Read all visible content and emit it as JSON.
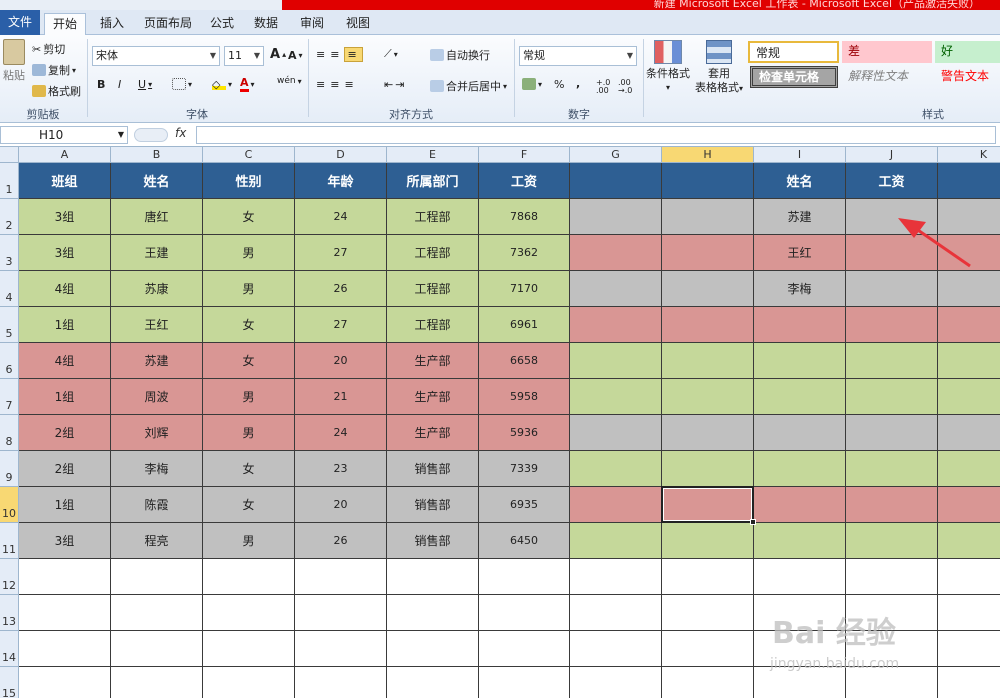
{
  "window": {
    "title": "新建 Microsoft Excel 工作表 - Microsoft Excel（产品激活失败）"
  },
  "tabs": [
    {
      "label": "文件",
      "kind": "file"
    },
    {
      "label": "开始",
      "active": true
    },
    {
      "label": "插入"
    },
    {
      "label": "页面布局"
    },
    {
      "label": "公式"
    },
    {
      "label": "数据"
    },
    {
      "label": "审阅"
    },
    {
      "label": "视图"
    }
  ],
  "ribbon": {
    "clipboard": {
      "paste": "粘贴",
      "cut": "剪切",
      "copy": "复制",
      "format_painter": "格式刷",
      "label": "剪贴板"
    },
    "font": {
      "name": "宋体",
      "size": "11",
      "grow": "A",
      "shrink": "A",
      "bold": "B",
      "italic": "I",
      "underline": "U",
      "font_color_letter": "A",
      "phonetic": "wén",
      "label": "字体"
    },
    "alignment": {
      "wrap_text": "自动换行",
      "merge_center": "合并后居中",
      "label": "对齐方式"
    },
    "number": {
      "format": "常规",
      "percent": "%",
      "comma": ",",
      "inc_decimal": "+.0 .00",
      "dec_decimal": ".00 →.0",
      "label": "数字"
    },
    "styles_btns": {
      "conditional": "条件格式",
      "table_format_1": "套用",
      "table_format_2": "表格格式",
      "label": "样式"
    },
    "styles": [
      {
        "label": "常规",
        "kind": "normal"
      },
      {
        "label": "差",
        "kind": "bad"
      },
      {
        "label": "好",
        "kind": "good"
      },
      {
        "label": "检查单元格",
        "kind": "check"
      },
      {
        "label": "解释性文本",
        "kind": "explain"
      },
      {
        "label": "警告文本",
        "kind": "warn"
      }
    ]
  },
  "formula_bar": {
    "name_box": "H10",
    "fx": "fx",
    "value": ""
  },
  "columns": [
    "A",
    "B",
    "C",
    "D",
    "E",
    "F",
    "G",
    "H",
    "I",
    "J",
    "K"
  ],
  "rows": [
    "1",
    "2",
    "3",
    "4",
    "5",
    "6",
    "7",
    "8",
    "9",
    "10",
    "11",
    "12",
    "13",
    "14",
    "15"
  ],
  "selected_cell": {
    "column": "H",
    "row": "10"
  },
  "table": {
    "headers": [
      "班组",
      "姓名",
      "性别",
      "年龄",
      "所属部门",
      "工资"
    ],
    "rows": [
      [
        "3组",
        "唐红",
        "女",
        "24",
        "工程部",
        "7868"
      ],
      [
        "3组",
        "王建",
        "男",
        "27",
        "工程部",
        "7362"
      ],
      [
        "4组",
        "苏康",
        "男",
        "26",
        "工程部",
        "7170"
      ],
      [
        "1组",
        "王红",
        "女",
        "27",
        "工程部",
        "6961"
      ],
      [
        "4组",
        "苏建",
        "女",
        "20",
        "生产部",
        "6658"
      ],
      [
        "1组",
        "周波",
        "男",
        "21",
        "生产部",
        "5958"
      ],
      [
        "2组",
        "刘辉",
        "男",
        "24",
        "生产部",
        "5936"
      ],
      [
        "2组",
        "李梅",
        "女",
        "23",
        "销售部",
        "7339"
      ],
      [
        "1组",
        "陈霞",
        "女",
        "20",
        "销售部",
        "6935"
      ],
      [
        "3组",
        "程亮",
        "男",
        "26",
        "销售部",
        "6450"
      ]
    ],
    "row_fill": [
      "g",
      "g",
      "g",
      "g",
      "r",
      "r",
      "r",
      "s",
      "s",
      "s"
    ]
  },
  "lookup": {
    "headers": [
      "姓名",
      "工资"
    ],
    "names": [
      "苏建",
      "王红",
      "李梅"
    ],
    "row_fill": [
      "s",
      "r",
      "s",
      "r",
      "g",
      "g",
      "s",
      "g",
      "r",
      "g"
    ]
  },
  "colors": {
    "header": "#2e5f93",
    "green": "#c5d89a",
    "red": "#d99694",
    "gray": "#c0c0c0",
    "annotation_arrow": "#e8343a"
  },
  "watermark": {
    "main": "Bai 经验",
    "sub": "jingyan.baidu.com"
  }
}
